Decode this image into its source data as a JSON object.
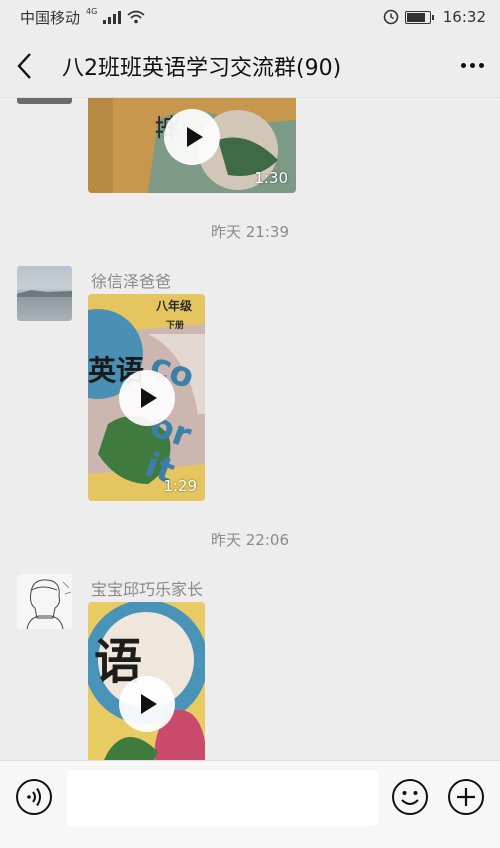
{
  "status_bar": {
    "carrier": "中国移动",
    "network_tag": "4G",
    "time": "16:32"
  },
  "header": {
    "title": "八2班班英语学习交流群(90)"
  },
  "messages": [
    {
      "type": "video",
      "duration": "1:30"
    },
    {
      "type": "timestamp",
      "text": "昨天 21:39"
    },
    {
      "type": "video",
      "sender": "徐信泽爸爸",
      "duration": "1:29",
      "cover_title": "英语",
      "cover_grade": "八年级",
      "cover_sub": "下册"
    },
    {
      "type": "timestamp",
      "text": "昨天 22:06"
    },
    {
      "type": "video",
      "sender": "宝宝邱巧乐家长",
      "cover_title": "语"
    }
  ],
  "input_bar": {
    "placeholder": ""
  },
  "colors": {
    "background": "#ededed",
    "timestamp": "#8a8a8a",
    "input_bar": "#f7f7f7"
  }
}
